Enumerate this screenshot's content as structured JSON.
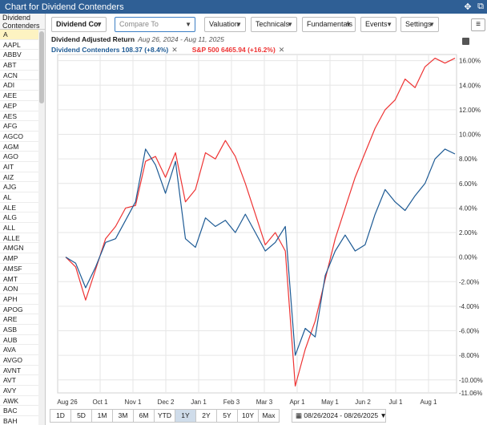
{
  "window": {
    "title": "Chart for Dividend Contenders"
  },
  "sidebar": {
    "header": "Dividend Contenders",
    "items": [
      "A",
      "AAPL",
      "ABBV",
      "ABT",
      "ACN",
      "ADI",
      "AEE",
      "AEP",
      "AES",
      "AFG",
      "AGCO",
      "AGM",
      "AGO",
      "AIT",
      "AIZ",
      "AJG",
      "AL",
      "ALE",
      "ALG",
      "ALL",
      "ALLE",
      "AMGN",
      "AMP",
      "AMSF",
      "AMT",
      "AON",
      "APH",
      "APOG",
      "ARE",
      "ASB",
      "AUB",
      "AVA",
      "AVGO",
      "AVNT",
      "AVT",
      "AVY",
      "AWK",
      "BAC",
      "BAH"
    ],
    "selected": "A"
  },
  "toolbar": {
    "symbol": "Dividend Cor",
    "compare_placeholder": "Compare To",
    "valuation": "Valuation",
    "technicals": "Technicals",
    "fundamentals": "Fundamentals",
    "events": "Events",
    "settings": "Settings"
  },
  "legend": {
    "title": "Dividend Adjusted Return",
    "daterange": "Aug 26, 2024 - Aug 11, 2025",
    "series1": "Dividend Contenders 108.37 (+8.4%)",
    "series2": "S&P 500 6465.94 (+16.2%)"
  },
  "periods": [
    "1D",
    "5D",
    "1M",
    "3M",
    "6M",
    "YTD",
    "1Y",
    "2Y",
    "5Y",
    "10Y",
    "Max"
  ],
  "active_period": "1Y",
  "date_range_field": "08/26/2024 - 08/26/2025",
  "chart_data": {
    "type": "line",
    "title": "Dividend Adjusted Return",
    "x_ticks": [
      "Aug 26",
      "Oct 1",
      "Nov 1",
      "Dec 2",
      "Jan 1",
      "Feb 3",
      "Mar 3",
      "Apr 1",
      "May 1",
      "Jun 2",
      "Jul 1",
      "Aug 1"
    ],
    "y_ticks": [
      "16.00%",
      "14.00%",
      "12.00%",
      "10.00%",
      "8.00%",
      "6.00%",
      "4.00%",
      "2.00%",
      "0.00%",
      "-2.00%",
      "-4.00%",
      "-6.00%",
      "-8.00%",
      "-10.00%",
      "-11.06%"
    ],
    "ylim": [
      -11.06,
      16.5
    ],
    "series": [
      {
        "name": "Dividend Contenders",
        "color": "#1d5a94",
        "values": [
          0.0,
          -0.5,
          -2.5,
          -0.8,
          1.2,
          1.5,
          3.0,
          4.5,
          8.8,
          7.5,
          5.2,
          7.8,
          1.5,
          0.8,
          3.2,
          2.5,
          3.0,
          2.0,
          3.5,
          2.0,
          0.5,
          1.2,
          2.5,
          -8.0,
          -5.8,
          -6.5,
          -1.5,
          0.5,
          1.8,
          0.5,
          1.0,
          3.5,
          5.5,
          4.5,
          3.8,
          5.0,
          6.0,
          8.0,
          8.8,
          8.4
        ]
      },
      {
        "name": "S&P 500",
        "color": "#e33",
        "values": [
          0.0,
          -0.8,
          -3.5,
          -1.0,
          1.5,
          2.5,
          4.0,
          4.2,
          7.8,
          8.2,
          6.5,
          8.5,
          4.5,
          5.5,
          8.5,
          8.0,
          9.5,
          8.2,
          6.0,
          3.5,
          1.0,
          2.0,
          0.5,
          -10.5,
          -7.5,
          -5.2,
          -1.8,
          1.5,
          4.0,
          6.5,
          8.5,
          10.5,
          12.0,
          12.8,
          14.5,
          13.8,
          15.5,
          16.2,
          15.8,
          16.2
        ]
      }
    ],
    "grid": true
  }
}
